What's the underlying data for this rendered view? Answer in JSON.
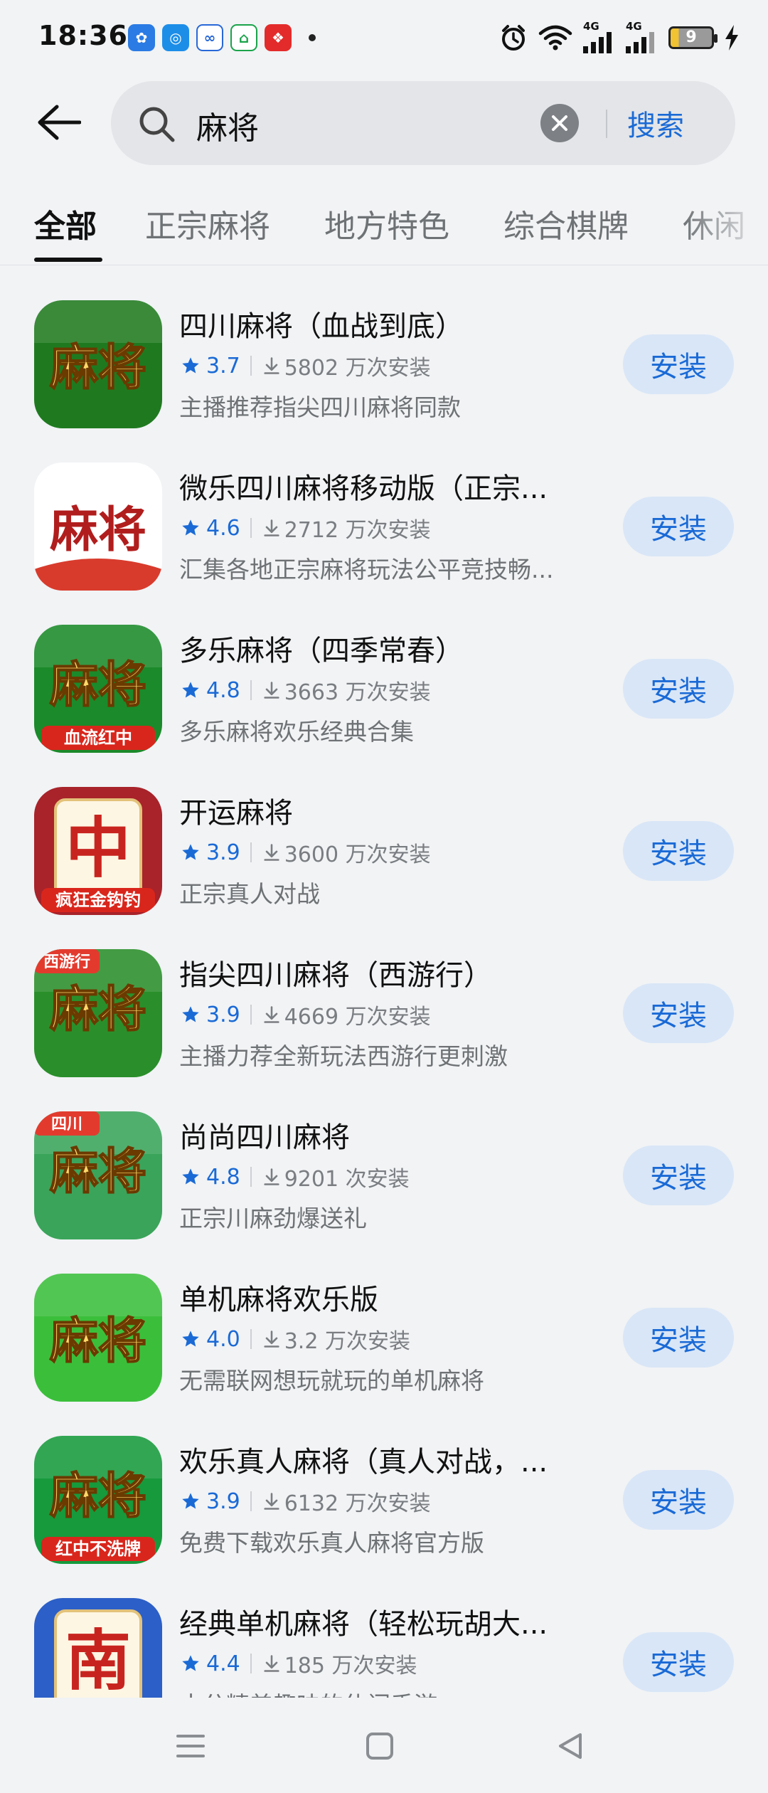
{
  "status_bar": {
    "time": "18:36",
    "battery": "9",
    "network_1": "4G",
    "network_2": "4G"
  },
  "search": {
    "query": "麻将",
    "search_button": "搜索"
  },
  "tabs": [
    "全部",
    "正宗麻将",
    "地方特色",
    "综合棋牌",
    "休闲"
  ],
  "install_label": "安装",
  "apps": [
    {
      "name": "四川麻将（血战到底）",
      "rating": "3.7",
      "installs": "5802 万次安装",
      "desc": "主播推荐指尖四川麻将同款",
      "icon_text": "麻将",
      "badge": "",
      "icon_bg": "#1f7a1f"
    },
    {
      "name": "微乐四川麻将移动版（正宗...",
      "rating": "4.6",
      "installs": "2712 万次安装",
      "desc": "汇集各地正宗麻将玩法公平竞技畅...",
      "icon_text": "麻将",
      "badge": "",
      "icon_bg": "#ffffff"
    },
    {
      "name": "多乐麻将（四季常春）",
      "rating": "4.8",
      "installs": "3663 万次安装",
      "desc": "多乐麻将欢乐经典合集",
      "icon_text": "麻将",
      "badge": "血流红中",
      "icon_bg": "#1b8a2a"
    },
    {
      "name": "开运麻将",
      "rating": "3.9",
      "installs": "3600 万次安装",
      "desc": "正宗真人对战",
      "icon_text": "中",
      "badge": "疯狂金钩钓",
      "icon_bg": "#a8232a"
    },
    {
      "name": "指尖四川麻将（西游行）",
      "rating": "3.9",
      "installs": "4669 万次安装",
      "desc": "主播力荐全新玩法西游行更刺激",
      "icon_text": "麻将",
      "badge": "西游行",
      "icon_bg": "#2a8f2a"
    },
    {
      "name": "尚尚四川麻将",
      "rating": "4.8",
      "installs": "9201 次安装",
      "desc": "正宗川麻劲爆送礼",
      "icon_text": "麻将",
      "badge": "四川",
      "icon_bg": "#3aa45a"
    },
    {
      "name": "单机麻将欢乐版",
      "rating": "4.0",
      "installs": "3.2 万次安装",
      "desc": "无需联网想玩就玩的单机麻将",
      "icon_text": "麻将",
      "badge": "",
      "icon_bg": "#3bbf3b"
    },
    {
      "name": "欢乐真人麻将（真人对战，...",
      "rating": "3.9",
      "installs": "6132 万次安装",
      "desc": "免费下载欢乐真人麻将官方版",
      "icon_text": "麻将",
      "badge": "红中不洗牌",
      "icon_bg": "#169a3c"
    },
    {
      "name": "经典单机麻将（轻松玩胡大...",
      "rating": "4.4",
      "installs": "185 万次安装",
      "desc": "十分精美趣味的休闲手游",
      "icon_text": "南",
      "badge": "",
      "icon_bg": "#2c5fc7"
    }
  ]
}
